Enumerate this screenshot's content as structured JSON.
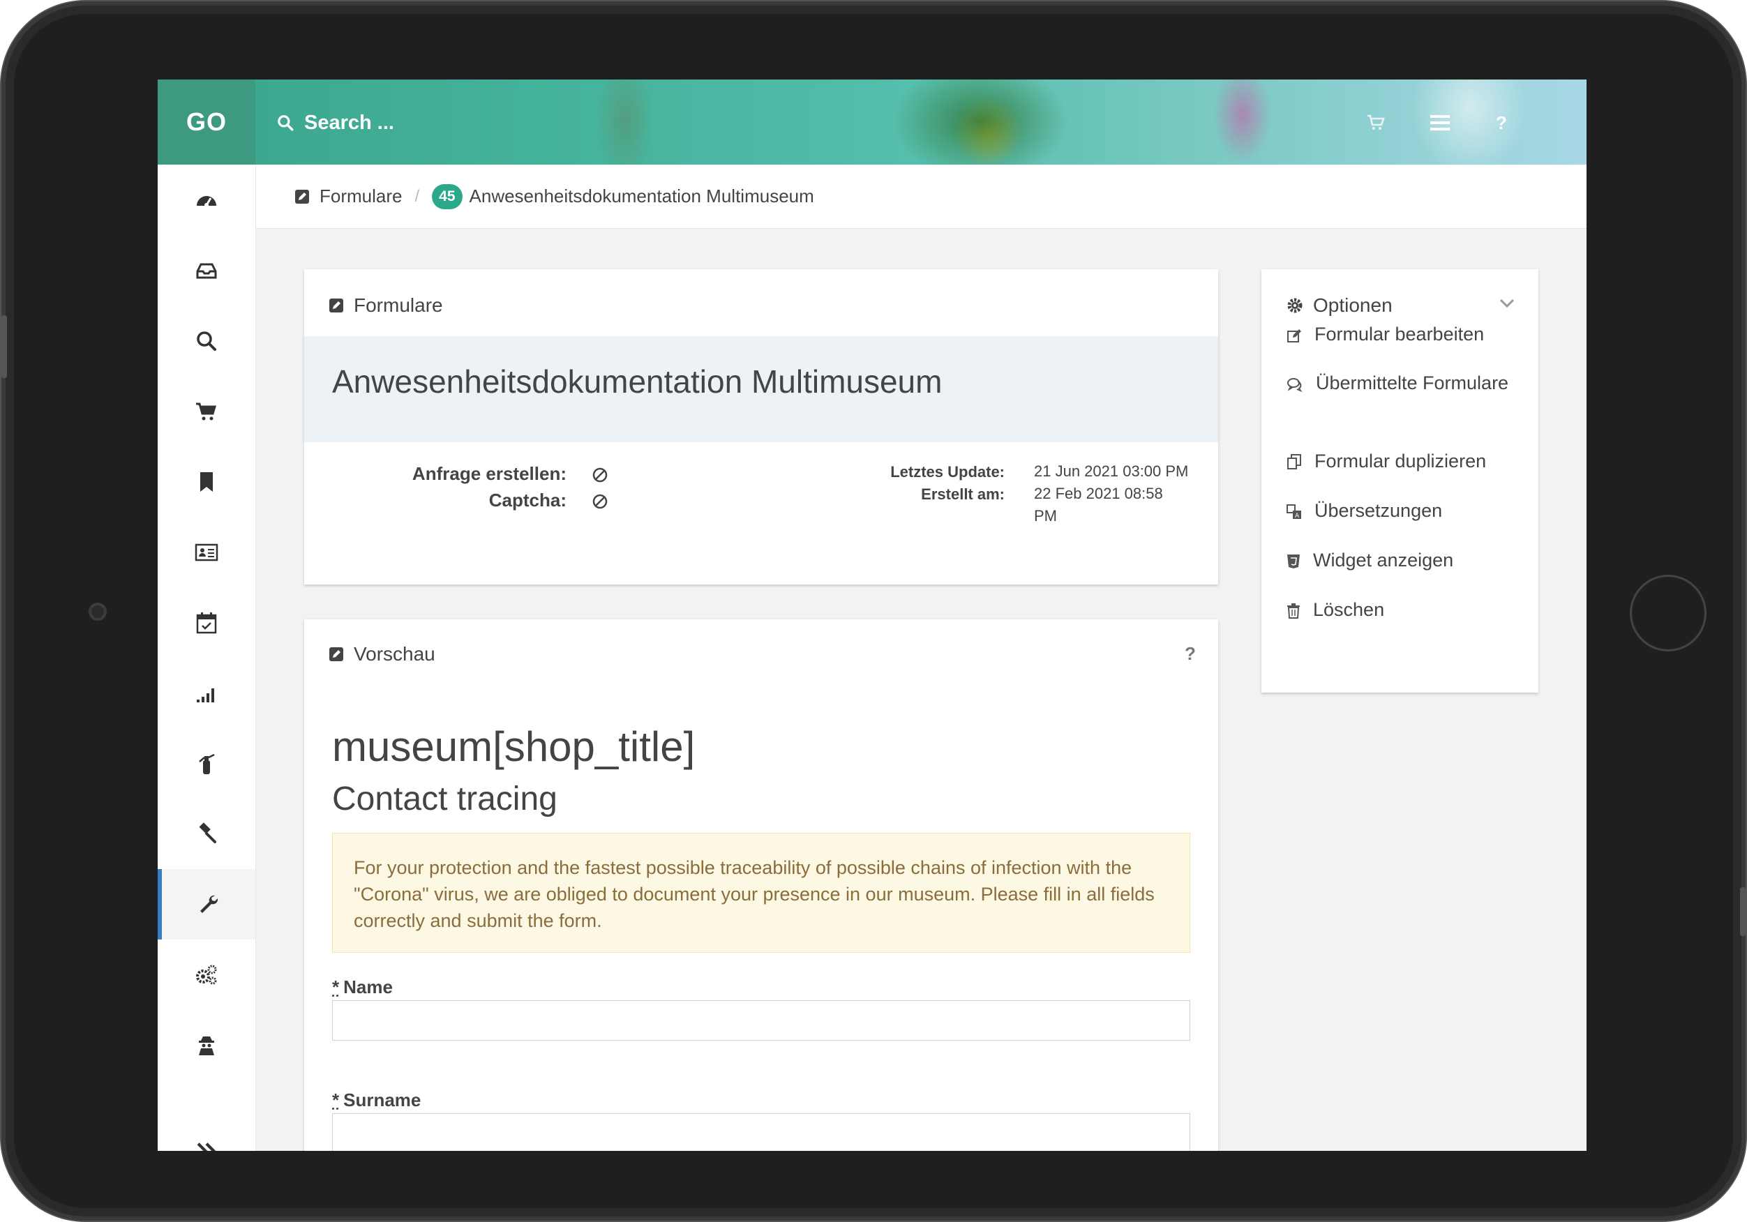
{
  "header": {
    "logo": "GO",
    "search_placeholder": "Search ...",
    "help_label": "?"
  },
  "breadcrumb": {
    "root": "Formulare",
    "separator": "/",
    "badge": "45",
    "current": "Anwesenheitsdokumentation Multimuseum"
  },
  "sidebar": {
    "items": [
      {
        "icon": "dashboard-icon"
      },
      {
        "icon": "inbox-icon"
      },
      {
        "icon": "search-icon"
      },
      {
        "icon": "cart-icon"
      },
      {
        "icon": "bookmark-icon"
      },
      {
        "icon": "contact-card-icon"
      },
      {
        "icon": "calendar-check-icon"
      },
      {
        "icon": "signal-bars-icon"
      },
      {
        "icon": "fire-extinguisher-icon"
      },
      {
        "icon": "gavel-icon"
      },
      {
        "icon": "wrench-icon",
        "active": true
      },
      {
        "icon": "cogs-icon"
      },
      {
        "icon": "user-secret-icon"
      }
    ],
    "expand_icon": "double-chevron-right-icon"
  },
  "form_card": {
    "title": "Formulare",
    "heading": "Anwesenheitsdokumentation Multimuseum",
    "anfrage_label": "Anfrage erstellen:",
    "captcha_label": "Captcha:",
    "letztes_update_label": "Letztes Update:",
    "letztes_update_value": "21 Jun 2021 03:00 PM",
    "erstellt_label": "Erstellt am:",
    "erstellt_value_line1": "22 Feb 2021 08:58",
    "erstellt_value_line2": "PM"
  },
  "preview_card": {
    "title": "Vorschau",
    "help": "?",
    "shop_title": "museum[shop_title]",
    "subtitle": "Contact tracing",
    "alert_line1": "For your protection and the fastest possible traceability of possible chains of infection with the",
    "alert_line2": "\"Corona\" virus, we are obliged to document your presence in our museum. Please fill in all fields",
    "alert_line3": "correctly and submit the form.",
    "required_mark": "*",
    "fields": [
      {
        "label": "Name",
        "value": ""
      },
      {
        "label": "Surname",
        "value": ""
      }
    ]
  },
  "options_card": {
    "title": "Optionen",
    "items": [
      {
        "label": "Formular bearbeiten",
        "icon": "edit-icon"
      },
      {
        "label": "Übermittelte Formulare",
        "icon": "comments-icon"
      },
      {
        "label": "Formular duplizieren",
        "icon": "copy-icon"
      },
      {
        "label": "Übersetzungen",
        "icon": "translate-icon"
      },
      {
        "label": "Widget anzeigen",
        "icon": "html5-icon"
      },
      {
        "label": "Löschen",
        "icon": "trash-icon"
      }
    ]
  }
}
